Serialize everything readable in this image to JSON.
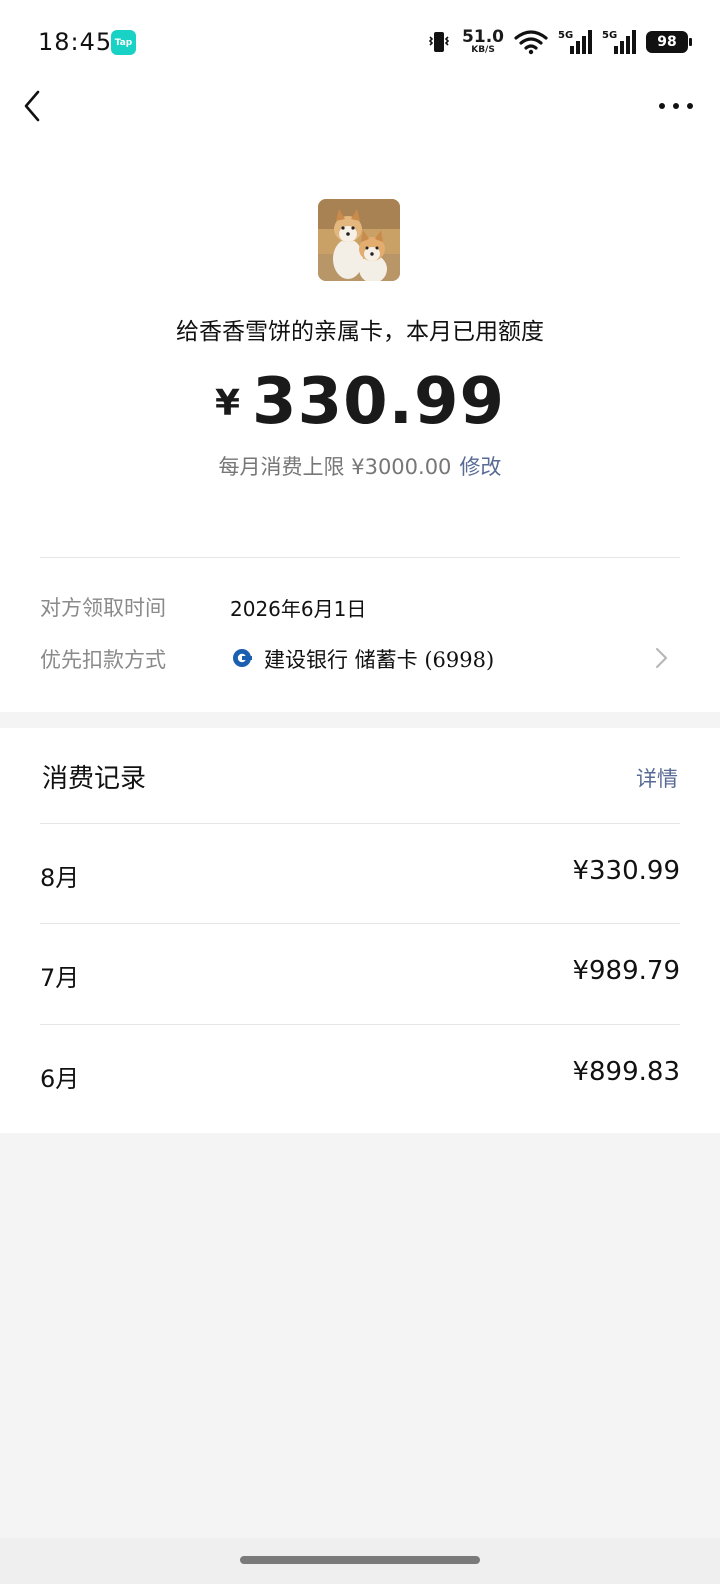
{
  "status_bar": {
    "time": "18:45",
    "tap_badge": "Tap",
    "net_speed": "51.0",
    "net_unit": "KB/S",
    "signal1_label": "5G",
    "signal2_label": "5G",
    "battery": "98"
  },
  "card": {
    "headline": "给香香雪饼的亲属卡，本月已用额度",
    "currency_symbol": "¥",
    "used_amount": "330.99",
    "limit_text": "每月消费上限 ¥3000.00",
    "edit_label": "修改"
  },
  "info": {
    "claim_time_label": "对方领取时间",
    "claim_time_value": "2026年6月1日",
    "payment_label": "优先扣款方式",
    "payment_value": "建设银行 储蓄卡 (6998)"
  },
  "records": {
    "title": "消费记录",
    "detail_label": "详情",
    "items": [
      {
        "month": "8月",
        "amount": "¥330.99"
      },
      {
        "month": "7月",
        "amount": "¥989.79"
      },
      {
        "month": "6月",
        "amount": "¥899.83"
      }
    ]
  },
  "colors": {
    "link": "#576b95",
    "tap_badge": "#19d2c6",
    "bank_icon": "#1b5fb0"
  }
}
